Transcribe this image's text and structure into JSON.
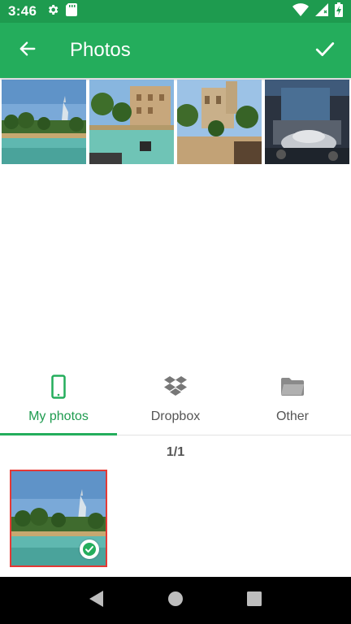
{
  "status_bar": {
    "time": "3:46",
    "left_icons": [
      "gear-icon",
      "sd-card-icon"
    ],
    "right_icons": [
      "wifi-icon",
      "signal-icon",
      "battery-charging-icon"
    ]
  },
  "app_bar": {
    "title": "Photos",
    "back_icon": "arrow-back-icon",
    "confirm_icon": "check-icon",
    "color": "#24ad5c"
  },
  "selected_strip": {
    "photos": [
      {
        "subject": "burj-al-arab-waterfront"
      },
      {
        "subject": "canal-with-buildings"
      },
      {
        "subject": "courtyard-with-palms"
      },
      {
        "subject": "interior-hall"
      }
    ]
  },
  "tabs": [
    {
      "label": "My photos",
      "icon": "phone-icon",
      "active": true
    },
    {
      "label": "Dropbox",
      "icon": "dropbox-icon",
      "active": false
    },
    {
      "label": "Other",
      "icon": "folder-icon",
      "active": false
    }
  ],
  "counter": "1/1",
  "gallery": {
    "items": [
      {
        "subject": "burj-al-arab-waterfront",
        "selected": true
      }
    ]
  },
  "nav_bar": {
    "buttons": [
      "back-triangle-icon",
      "home-circle-icon",
      "recents-square-icon"
    ]
  },
  "colors": {
    "accent": "#24ad5c",
    "status": "#1e9b4f",
    "selection_border": "#e53935"
  }
}
